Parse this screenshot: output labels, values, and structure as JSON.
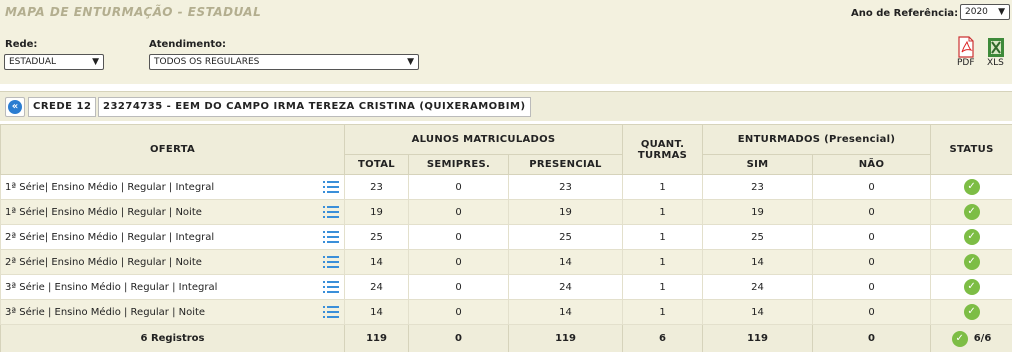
{
  "header": {
    "title": "MAPA DE ENTURMAÇÃO - ESTADUAL",
    "ref_label": "Ano de Referência:",
    "ref_value": "2020"
  },
  "filters": {
    "rede_label": "Rede:",
    "rede_value": "ESTADUAL",
    "atend_label": "Atendimento:",
    "atend_value": "TODOS OS REGULARES"
  },
  "exports": {
    "pdf": "PDF",
    "xls": "XLS"
  },
  "breadcrumb": {
    "crede": "CREDE 12",
    "school": "23274735 - EEM DO CAMPO IRMA TEREZA CRISTINA (QUIXERAMOBIM)"
  },
  "table": {
    "headers": {
      "oferta": "OFERTA",
      "alunos": "ALUNOS MATRICULADOS",
      "total": "TOTAL",
      "semipres": "SEMIPRES.",
      "presencial": "PRESENCIAL",
      "quant": "QUANT. TURMAS",
      "enturmados": "ENTURMADOS (Presencial)",
      "sim": "SIM",
      "nao": "NÃO",
      "status": "STATUS"
    },
    "rows": [
      {
        "oferta": "1ª Série| Ensino Médio | Regular | Integral",
        "total": "23",
        "semipres": "0",
        "presencial": "23",
        "turmas": "1",
        "sim": "23",
        "nao": "0"
      },
      {
        "oferta": "1ª Série| Ensino Médio | Regular | Noite",
        "total": "19",
        "semipres": "0",
        "presencial": "19",
        "turmas": "1",
        "sim": "19",
        "nao": "0"
      },
      {
        "oferta": "2ª Série| Ensino Médio | Regular | Integral",
        "total": "25",
        "semipres": "0",
        "presencial": "25",
        "turmas": "1",
        "sim": "25",
        "nao": "0"
      },
      {
        "oferta": "2ª Série| Ensino Médio | Regular | Noite",
        "total": "14",
        "semipres": "0",
        "presencial": "14",
        "turmas": "1",
        "sim": "14",
        "nao": "0"
      },
      {
        "oferta": "3ª Série | Ensino Médio | Regular | Integral",
        "total": "24",
        "semipres": "0",
        "presencial": "24",
        "turmas": "1",
        "sim": "24",
        "nao": "0"
      },
      {
        "oferta": "3ª Série | Ensino Médio | Regular | Noite",
        "total": "14",
        "semipres": "0",
        "presencial": "14",
        "turmas": "1",
        "sim": "14",
        "nao": "0"
      }
    ],
    "footer": {
      "registros": "6 Registros",
      "total": "119",
      "semipres": "0",
      "presencial": "119",
      "turmas": "6",
      "sim": "119",
      "nao": "0",
      "status": "6/6"
    }
  },
  "colors": {
    "accent": "#2b7dd1",
    "ok": "#7dbd45",
    "header_bg": "#efedda",
    "title": "#b3ae8f"
  },
  "icons": {
    "back": "double-chevron-left-icon",
    "row_action": "list-icon",
    "status": "check-circle-icon"
  }
}
